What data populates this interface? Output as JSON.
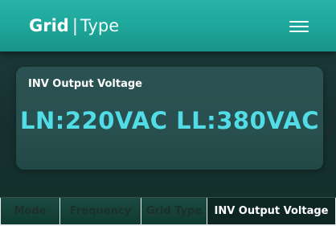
{
  "header": {
    "title_strong": "Grid",
    "title_sep": "|",
    "title_light": "Type"
  },
  "card": {
    "label": "INV Output Voltage",
    "value": "LN:220VAC LL:380VAC"
  },
  "tabs": [
    {
      "label": "Mode",
      "active": false
    },
    {
      "label": "Frequency",
      "active": false
    },
    {
      "label": "Grid Type",
      "active": false
    },
    {
      "label": "INV Output Voltage",
      "active": true
    }
  ],
  "icons": {
    "menu": "hamburger-menu-icon"
  },
  "colors": {
    "accent": "#1fa89d",
    "value_text": "#52dde6",
    "background": "#17302f"
  }
}
